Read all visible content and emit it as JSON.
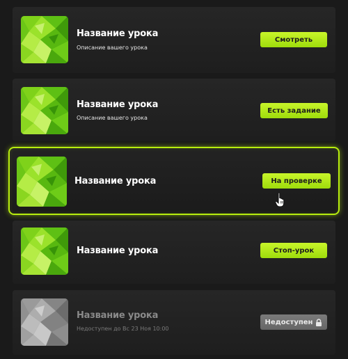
{
  "lessons": [
    {
      "title": "Название урока",
      "description": "Описание вашего урока",
      "button": "Смотреть"
    },
    {
      "title": "Название урока",
      "description": "Описание вашего урока",
      "button": "Есть задание"
    },
    {
      "title": "Название урока",
      "button": "На проверке"
    },
    {
      "title": "Название урока",
      "button": "Стоп-урок"
    },
    {
      "title": "Название урока",
      "description": "Недоступен до Вс 23 Ноя 10:00",
      "button": "Недоступен"
    }
  ],
  "colors": {
    "accent": "#b8ee0e",
    "card": "#242424",
    "disabled": "#707070"
  }
}
